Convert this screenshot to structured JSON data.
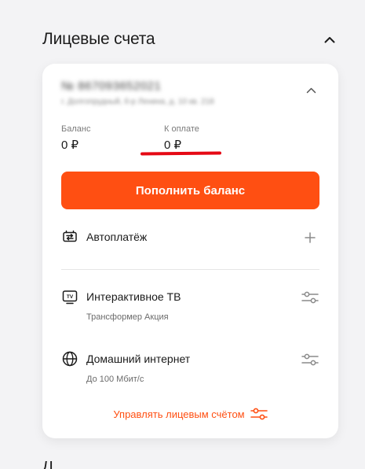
{
  "section": {
    "title": "Лицевые счета"
  },
  "account": {
    "number": "№ 867093652021",
    "address": "г. Долгопрудный, б-р Ленина, д. 10 кв. 218"
  },
  "balance": {
    "label": "Баланс",
    "value": "0 ₽"
  },
  "due": {
    "label": "К оплате",
    "value": "0 ₽"
  },
  "topup_button": "Пополнить баланс",
  "services": [
    {
      "title": "Автоплатёж",
      "icon": "autopay-icon",
      "action_icon": "plus-icon"
    },
    {
      "title": "Интерактивное ТВ",
      "subtitle": "Трансформер Акция",
      "icon": "tv-icon",
      "action_icon": "settings-sliders-icon"
    },
    {
      "title": "Домашний интернет",
      "subtitle": "До 100 Мбит/с",
      "icon": "globe-icon",
      "action_icon": "settings-sliders-icon"
    }
  ],
  "manage_link": "Управлять лицевым счётом",
  "next_section_partial": "Л",
  "colors": {
    "accent": "#ff4f12",
    "annotation": "#e50914",
    "card": "#ffffff",
    "background": "#f3f3f5"
  }
}
